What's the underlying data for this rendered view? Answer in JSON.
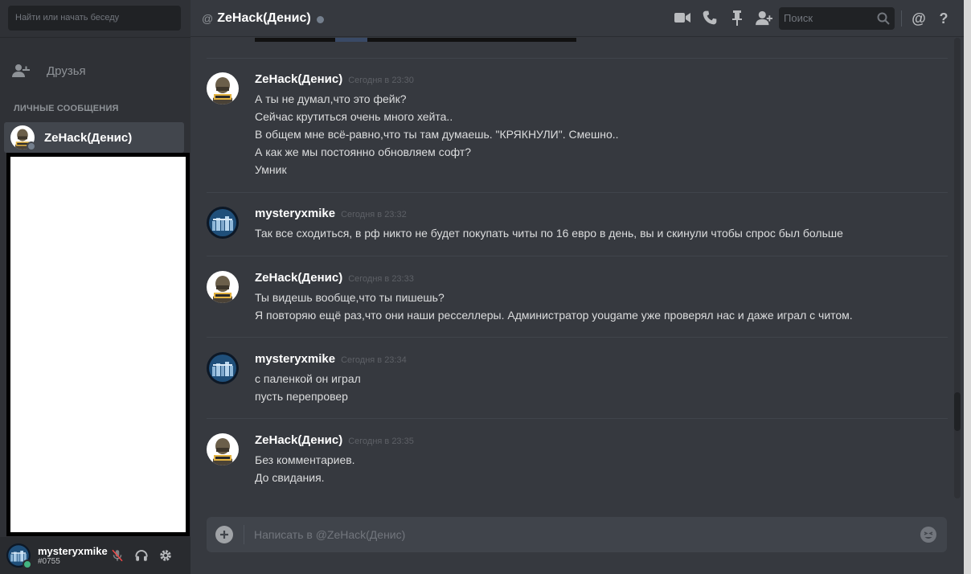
{
  "sidebar": {
    "search_placeholder": "Найти или начать беседу",
    "friends_label": "Друзья",
    "dm_header": "ЛИЧНЫЕ СООБЩЕНИЯ",
    "dm_items": [
      {
        "name": "ZeHack(Денис)",
        "status": "offline"
      }
    ]
  },
  "user_panel": {
    "username": "mysteryxmike",
    "tag": "#0755",
    "status": "online"
  },
  "header": {
    "at_symbol": "@",
    "channel_title": "ZeHack(Денис)",
    "search_placeholder": "Поиск",
    "mention_label": "@",
    "help_label": "?"
  },
  "messages": [
    {
      "author": "ZeHack(Денис)",
      "avatar": "pubg-helmet-avatar",
      "time": "Сегодня в 23:30",
      "lines": [
        "А ты не думал,что это фейк?",
        "Сейчас крутиться очень много хейта..",
        "В общем мне всё-равно,что ты там думаешь. \"КРЯКНУЛИ\". Смешно..",
        "А как же мы постоянно обновляем софт?",
        "Умник"
      ]
    },
    {
      "author": "mysteryxmike",
      "avatar": "city-skyline-avatar",
      "time": "Сегодня в 23:32",
      "lines": [
        "Так все сходиться, в рф никто не будет покупать  читы по 16 евро в день, вы и скинули чтобы спрос был больше"
      ]
    },
    {
      "author": "ZeHack(Денис)",
      "avatar": "pubg-helmet-avatar",
      "time": "Сегодня в 23:33",
      "lines": [
        "Ты видешь вообще,что ты пишешь?",
        "Я повторяю ещё раз,что они наши ресселлеры. Администратор yougame уже проверял нас и даже играл с читом."
      ]
    },
    {
      "author": "mysteryxmike",
      "avatar": "city-skyline-avatar",
      "time": "Сегодня в 23:34",
      "lines": [
        "с паленкой он играл",
        "пусть перепровер"
      ]
    },
    {
      "author": "ZeHack(Денис)",
      "avatar": "pubg-helmet-avatar",
      "time": "Сегодня в 23:35",
      "lines": [
        "Без комментариев.",
        "До свидания."
      ]
    }
  ],
  "composer": {
    "placeholder": "Написать в @ZeHack(Денис)"
  },
  "colors": {
    "background": "#36393f",
    "sidebar": "#2f3136",
    "online": "#43b581",
    "offline": "#747f8d"
  }
}
